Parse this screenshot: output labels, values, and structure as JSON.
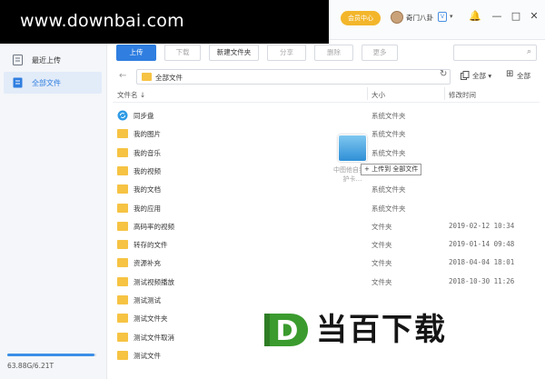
{
  "watermark_top": "www.downbai.com",
  "watermark_bottom": "当百下载",
  "watermark_logo_letter": "D",
  "header": {
    "vip_label": "会员中心",
    "username": "奇门八卦",
    "badge": "V",
    "caret": "▾",
    "window_buttons": [
      "🔔",
      "—",
      "□",
      "✕"
    ]
  },
  "sidebar": {
    "items": [
      {
        "label": "最近上传",
        "icon": "recent-icon"
      },
      {
        "label": "全部文件",
        "icon": "all-files-icon",
        "active": true
      }
    ],
    "quota_text": "63.88G/6.21T",
    "quota_fraction": 0.98
  },
  "toolbar": {
    "upload": "上传",
    "download": "下载",
    "new_folder": "新建文件夹",
    "share": "分享",
    "delete": "删除",
    "more": "更多",
    "search_icon": "⌕"
  },
  "pathbar": {
    "back": "←",
    "path": "全部文件",
    "refresh": "↻",
    "sort_label": "全部",
    "sort_caret": "▾",
    "view_icon": "grid-icon",
    "view_glyph": "⊞"
  },
  "columns": {
    "name": "文件名",
    "name_sort": "↓",
    "size": "大小",
    "modified": "修改时间"
  },
  "files": [
    {
      "name": "同步盘",
      "type": "系统文件夹",
      "date": "",
      "icon": "sync-icon"
    },
    {
      "name": "我的图片",
      "type": "系统文件夹",
      "date": "",
      "icon": "folder-icon"
    },
    {
      "name": "我的音乐",
      "type": "系统文件夹",
      "date": "",
      "icon": "folder-icon"
    },
    {
      "name": "我的视频",
      "type": "系统文件夹",
      "date": "",
      "icon": "folder-icon"
    },
    {
      "name": "我的文档",
      "type": "系统文件夹",
      "date": "",
      "icon": "folder-icon"
    },
    {
      "name": "我的应用",
      "type": "系统文件夹",
      "date": "",
      "icon": "folder-icon"
    },
    {
      "name": "高码率的视频",
      "type": "文件夹",
      "date": "2019-02-12 10:34",
      "icon": "folder-icon"
    },
    {
      "name": "转存的文件",
      "type": "文件夹",
      "date": "2019-01-14 09:48",
      "icon": "folder-icon"
    },
    {
      "name": "资源补充",
      "type": "文件夹",
      "date": "2018-04-04 18:01",
      "icon": "folder-icon"
    },
    {
      "name": "测试视频播放",
      "type": "文件夹",
      "date": "2018-10-30 11:26",
      "icon": "folder-icon"
    },
    {
      "name": "测试测试",
      "type": "",
      "date": "",
      "icon": "folder-icon"
    },
    {
      "name": "测试文件夹",
      "type": "",
      "date": "",
      "icon": "folder-icon"
    },
    {
      "name": "测试文件取消",
      "type": "",
      "date": "",
      "icon": "folder-icon"
    },
    {
      "name": "测试文件",
      "type": "",
      "date": "",
      "icon": "folder-icon"
    }
  ],
  "drag": {
    "caption": "中图他自我的护卡…",
    "tip_plus": "+",
    "tip": "上传到 全部文件"
  }
}
